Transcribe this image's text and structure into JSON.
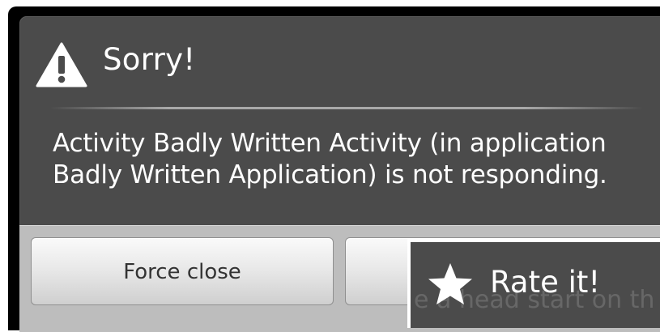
{
  "dialog": {
    "title": "Sorry!",
    "message": "Activity Badly Written Activity (in application Badly Written Application) is not responding.",
    "icon": "warning-icon"
  },
  "buttons": {
    "force_close_label": "Force close"
  },
  "popup": {
    "title": "Rate it!",
    "icon": "star-icon",
    "background_text": "e a head start on th"
  },
  "colors": {
    "dialog_bg": "#4b4b4b",
    "button_bar_bg": "#bdbdbd",
    "text": "#ffffff",
    "button_text": "#333333"
  }
}
